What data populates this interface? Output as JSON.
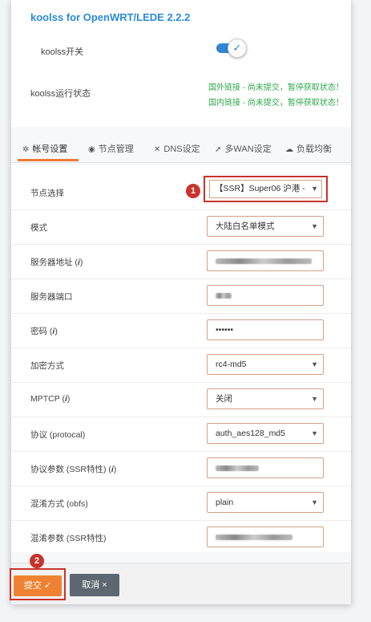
{
  "app": {
    "title": "koolss for OpenWRT/LEDE 2.2.2"
  },
  "status_card": {
    "switch_label": "koolss开关",
    "switch_on": true,
    "run_status_label": "koolss运行状态",
    "foreign_status": "国外链接 - 尚未提交，暂停获取状态！",
    "domestic_status": "国内链接 - 尚未提交，暂停获取状态！",
    "status_color": "#2ea84a"
  },
  "tabs": [
    {
      "label": "帐号设置",
      "icon": "gear-icon",
      "active": true
    },
    {
      "label": "节点管理",
      "icon": "globe-icon",
      "active": false
    },
    {
      "label": "DNS设定",
      "icon": "tools-icon",
      "active": false
    },
    {
      "label": "多WAN设定",
      "icon": "arrow-icon",
      "active": false
    },
    {
      "label": "负载均衡",
      "icon": "cloud-icon",
      "active": false
    }
  ],
  "form": {
    "node_label": "节点选择",
    "node_value": "【SSR】Super06 沪港 -",
    "mode_label": "模式",
    "mode_value": "大陆白名单模式",
    "server_label": "服务器地址 (",
    "server_info": "i",
    "server_label_end": ")",
    "port_label": "服务器端口",
    "password_label": "密码 (",
    "password_info": "i",
    "password_label_end": ")",
    "password_value": "••••••",
    "encrypt_label": "加密方式",
    "encrypt_value": "rc4-md5",
    "mptcp_label": "MPTCP (",
    "mptcp_info": "i",
    "mptcp_label_end": ")",
    "mptcp_value": "关闭",
    "protocol_label": "协议 (protocal)",
    "protocol_value": "auth_aes128_md5",
    "protocol_param_label": "协议参数 (SSR特性) (",
    "protocol_param_info": "i",
    "protocol_param_label_end": ")",
    "obfs_label": "混淆方式 (obfs)",
    "obfs_value": "plain",
    "obfs_param_label": "混淆参数 (SSR特性)"
  },
  "annotations": {
    "badge_1": "1",
    "badge_2": "2",
    "accent": "#c8332b"
  },
  "buttons": {
    "submit": "提交 ✓",
    "cancel": "取消 ×"
  }
}
